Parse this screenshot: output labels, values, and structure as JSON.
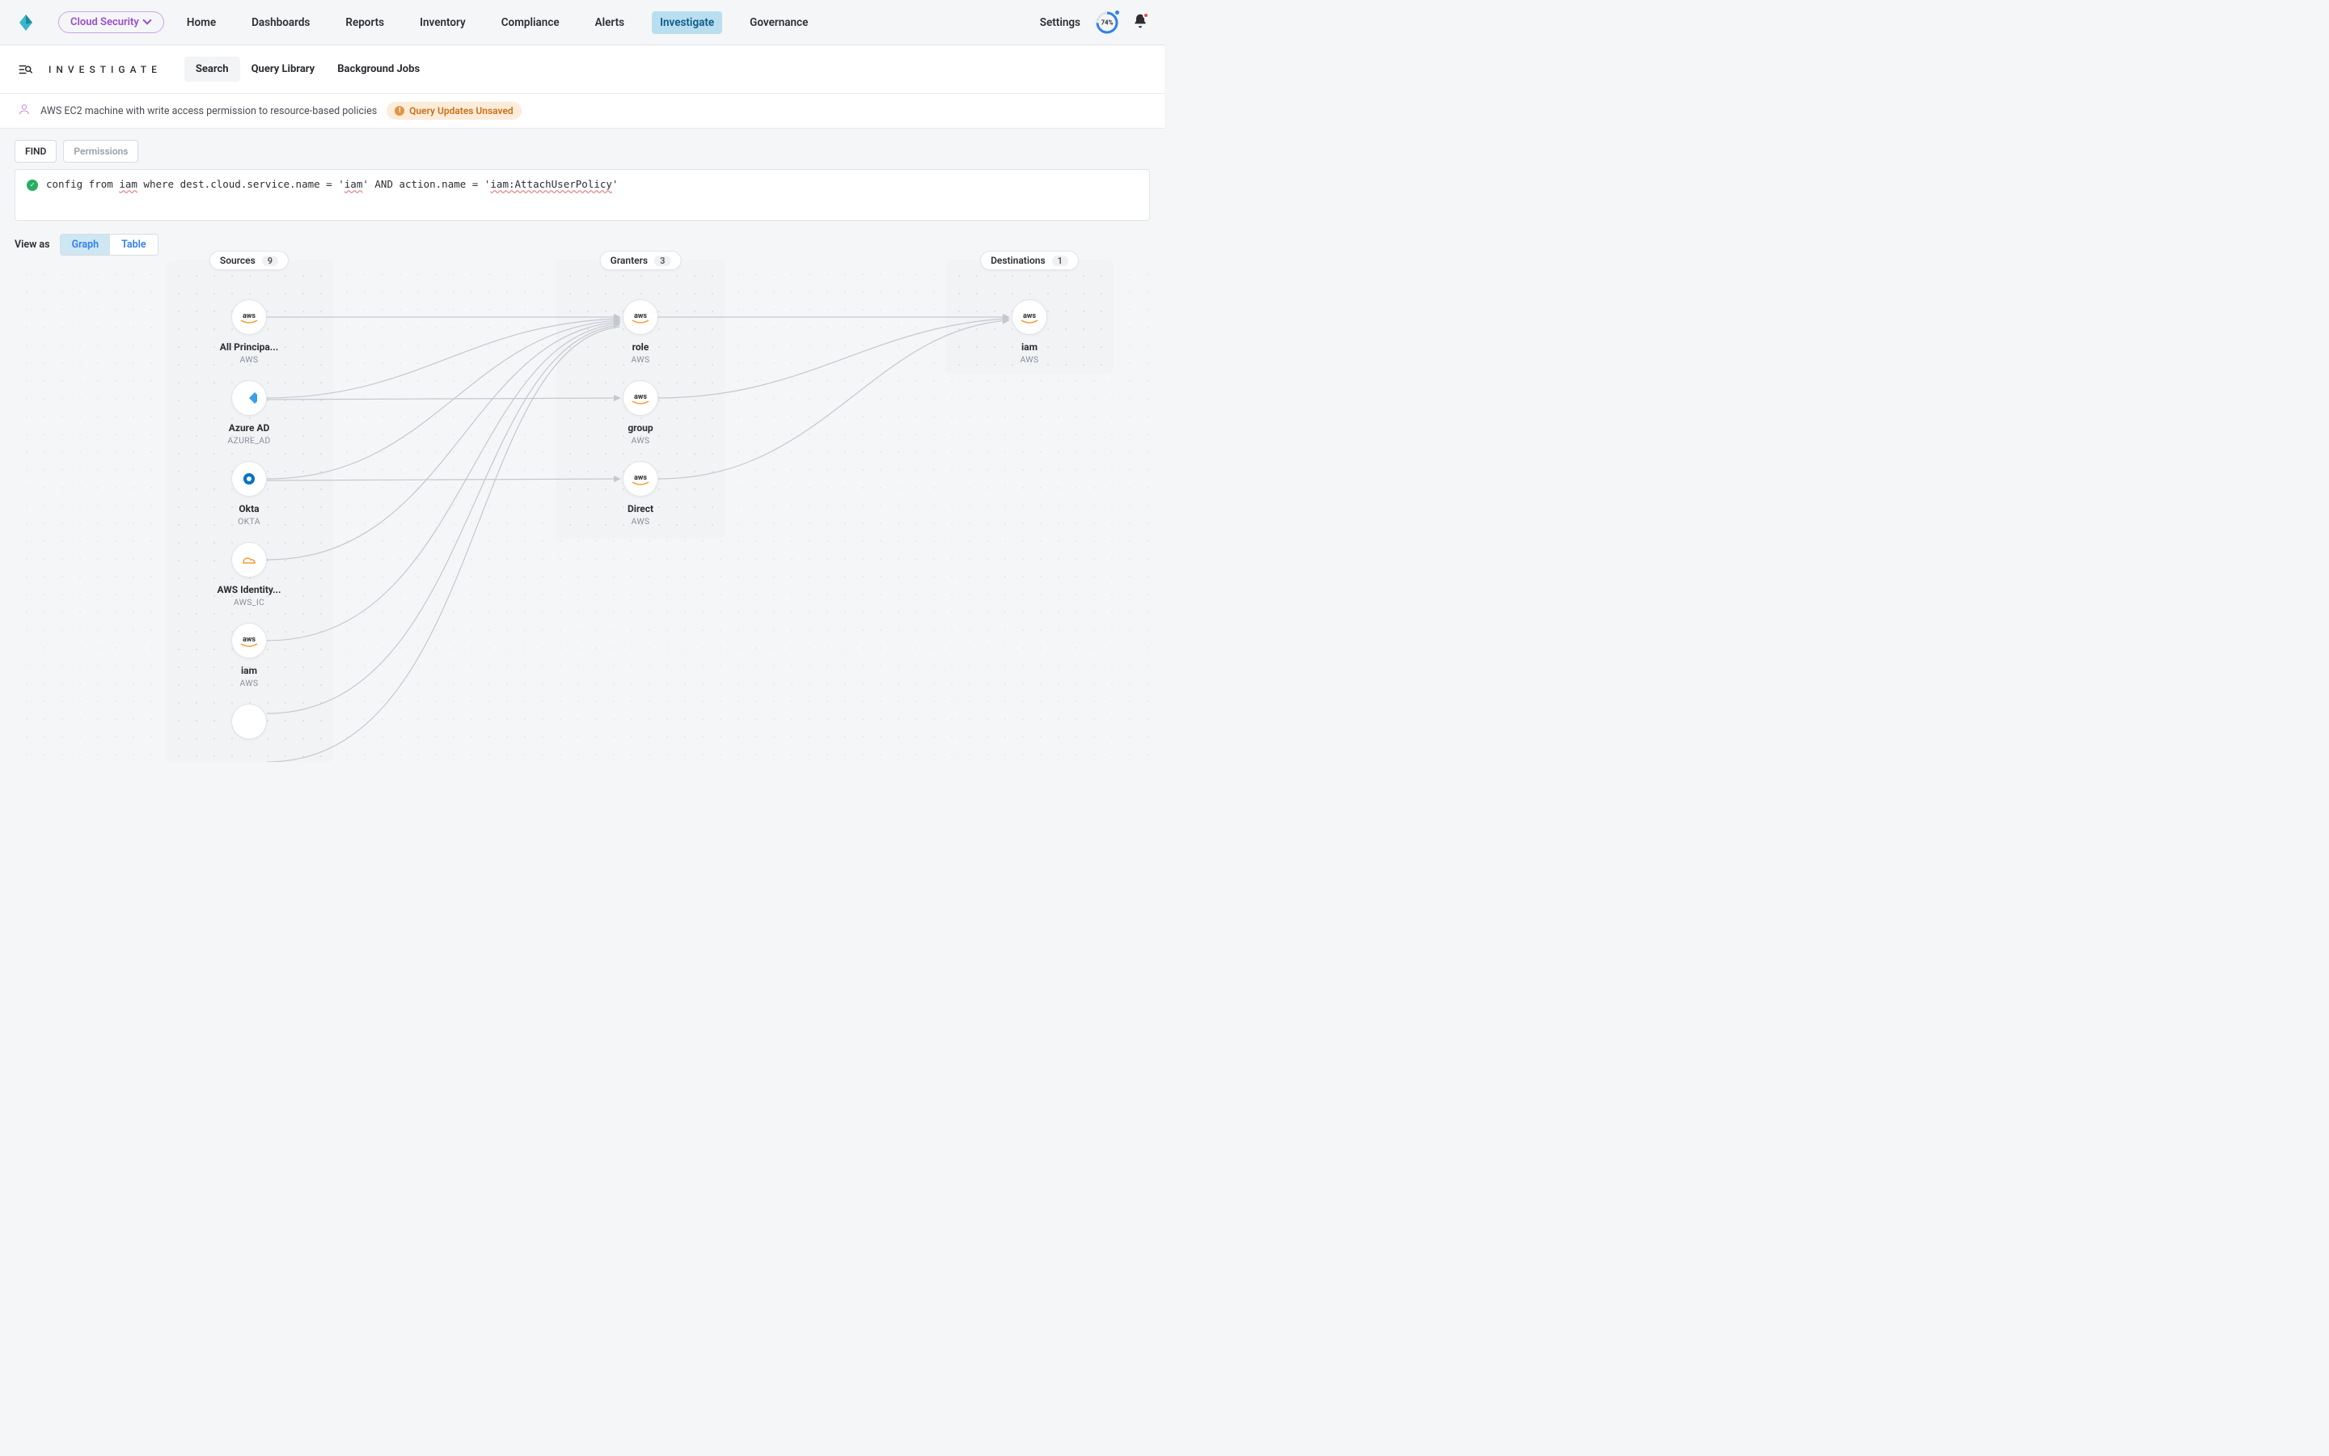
{
  "product": {
    "name": "Cloud Security"
  },
  "nav": {
    "items": [
      {
        "label": "Home"
      },
      {
        "label": "Dashboards"
      },
      {
        "label": "Reports"
      },
      {
        "label": "Inventory"
      },
      {
        "label": "Compliance"
      },
      {
        "label": "Alerts"
      },
      {
        "label": "Investigate",
        "active": true
      },
      {
        "label": "Governance"
      }
    ],
    "settings": "Settings",
    "progress_pct": "74%"
  },
  "subheader": {
    "title": "INVESTIGATE",
    "tabs": [
      {
        "label": "Search",
        "active": true
      },
      {
        "label": "Query Library"
      },
      {
        "label": "Background Jobs"
      }
    ]
  },
  "query_info": {
    "policy_text": "AWS EC2 machine with write access permission to resource-based policies",
    "unsaved_label": "Query Updates Unsaved"
  },
  "query": {
    "chips": [
      {
        "label": "FIND"
      },
      {
        "label": "Permissions",
        "muted": true
      }
    ],
    "text_parts": {
      "p1": "config from ",
      "p2": "iam",
      "p3": " where dest.cloud.service.name = '",
      "p4": "iam",
      "p5": "' AND action.name = '",
      "p6": "iam:AttachUserPolicy",
      "p7": "'"
    }
  },
  "viewas": {
    "label": "View as",
    "graph": "Graph",
    "table": "Table",
    "active": "Graph"
  },
  "graph": {
    "columns": {
      "sources": {
        "title": "Sources",
        "count": "9"
      },
      "granters": {
        "title": "Granters",
        "count": "3"
      },
      "destinations": {
        "title": "Destinations",
        "count": "1"
      }
    },
    "sources": [
      {
        "label": "All Principa...",
        "sub": "AWS",
        "icon": "aws"
      },
      {
        "label": "Azure AD",
        "sub": "AZURE_AD",
        "icon": "azuread"
      },
      {
        "label": "Okta",
        "sub": "OKTA",
        "icon": "okta"
      },
      {
        "label": "AWS Identity...",
        "sub": "AWS_IC",
        "icon": "awsic"
      },
      {
        "label": "iam",
        "sub": "AWS",
        "icon": "aws"
      }
    ],
    "granters": [
      {
        "label": "role",
        "sub": "AWS",
        "icon": "aws"
      },
      {
        "label": "group",
        "sub": "AWS",
        "icon": "aws"
      },
      {
        "label": "Direct",
        "sub": "AWS",
        "icon": "aws"
      }
    ],
    "destinations": [
      {
        "label": "iam",
        "sub": "AWS",
        "icon": "aws"
      }
    ]
  }
}
